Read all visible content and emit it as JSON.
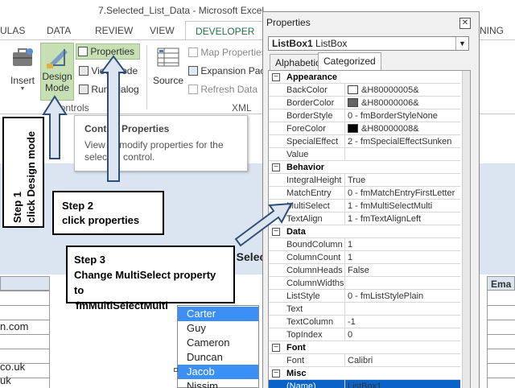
{
  "window": {
    "title": "7.Selected_List_Data - Microsoft Excel"
  },
  "tabs": [
    "ULAS",
    "DATA",
    "REVIEW",
    "VIEW",
    "DEVELOPER",
    "NING"
  ],
  "ribbon": {
    "insert_label": "Insert",
    "design_mode_label_1": "Design",
    "design_mode_label_2": "Mode",
    "properties_label": "Properties",
    "view_code_label": "View Code",
    "run_dialog_label": "Run Dialog",
    "controls_group": "Controls",
    "source_label": "Source",
    "map_properties_label": "Map Properties",
    "expansion_packs_label": "Expansion Packs",
    "refresh_data_label": "Refresh Data",
    "xml_group": "XML"
  },
  "tooltip": {
    "title": "Control Properties",
    "description": "View or modify properties for the selected control."
  },
  "steps": {
    "step1_line1": "Step 1",
    "step1_line2": "click Design mode",
    "step2_line1": "Step 2",
    "step2_line2": "click properties",
    "step3_line1": "Step 3",
    "step3_line2": "Change MultiSelect property to",
    "step3_line3": "fmMultiSelectMulti"
  },
  "properties": {
    "title": "Properties",
    "close": "✕",
    "object_name": "ListBox1",
    "object_type": "ListBox",
    "tab_alpha": "Alphabetic",
    "tab_cat": "Categorized",
    "rows": [
      {
        "type": "cat",
        "name": "Appearance"
      },
      {
        "type": "prop",
        "name": "BackColor",
        "value": "&H80000005&",
        "swatch": "#ffffff"
      },
      {
        "type": "prop",
        "name": "BorderColor",
        "value": "&H80000006&",
        "swatch": "#646464"
      },
      {
        "type": "prop",
        "name": "BorderStyle",
        "value": "0 - fmBorderStyleNone"
      },
      {
        "type": "prop",
        "name": "ForeColor",
        "value": "&H80000008&",
        "swatch": "#000000"
      },
      {
        "type": "prop",
        "name": "SpecialEffect",
        "value": "2 - fmSpecialEffectSunken"
      },
      {
        "type": "prop",
        "name": "Value",
        "value": ""
      },
      {
        "type": "cat",
        "name": "Behavior"
      },
      {
        "type": "prop",
        "name": "IntegralHeight",
        "value": "True"
      },
      {
        "type": "prop",
        "name": "MatchEntry",
        "value": "0 - fmMatchEntryFirstLetter"
      },
      {
        "type": "prop",
        "name": "MultiSelect",
        "value": "1 - fmMultiSelectMulti"
      },
      {
        "type": "prop",
        "name": "TextAlign",
        "value": "1 - fmTextAlignLeft"
      },
      {
        "type": "cat",
        "name": "Data"
      },
      {
        "type": "prop",
        "name": "BoundColumn",
        "value": "1"
      },
      {
        "type": "prop",
        "name": "ColumnCount",
        "value": "1"
      },
      {
        "type": "prop",
        "name": "ColumnHeads",
        "value": "False"
      },
      {
        "type": "prop",
        "name": "ColumnWidths",
        "value": ""
      },
      {
        "type": "prop",
        "name": "ListStyle",
        "value": "0 - fmListStylePlain"
      },
      {
        "type": "prop",
        "name": "Text",
        "value": ""
      },
      {
        "type": "prop",
        "name": "TextColumn",
        "value": "-1"
      },
      {
        "type": "prop",
        "name": "TopIndex",
        "value": "0"
      },
      {
        "type": "cat",
        "name": "Font"
      },
      {
        "type": "prop",
        "name": "Font",
        "value": "Calibri"
      },
      {
        "type": "cat",
        "name": "Misc"
      },
      {
        "type": "sel",
        "name": "(Name)",
        "value": "ListBox1"
      }
    ]
  },
  "listbox": {
    "items": [
      "Carter",
      "Guy",
      "Cameron",
      "Duncan",
      "Jacob",
      "Nissim"
    ],
    "selected_index": 4
  },
  "sheet": {
    "form_title_partial": "e Selec",
    "email_header": "Ema",
    "left_cells": [
      "n.com",
      "co.uk",
      "uk"
    ]
  },
  "colors": {
    "accent": "#217346",
    "arrow_fill": "#dde6f0",
    "arrow_stroke": "#2d4f7c",
    "selection": "#0a64c8"
  }
}
